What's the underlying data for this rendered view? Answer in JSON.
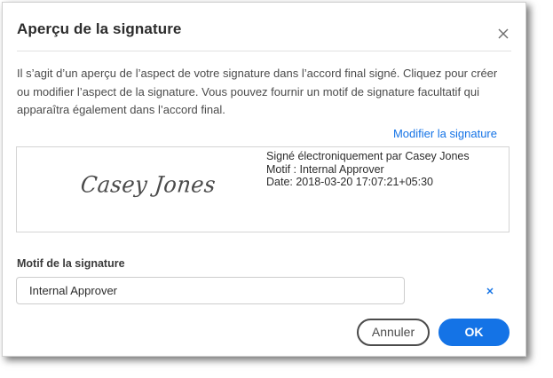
{
  "dialog": {
    "title": "Aperçu de la signature",
    "close_icon": "close-icon",
    "description": "Il s’agit d’un aperçu de l’aspect de votre signature dans l’accord final signé. Cliquez pour créer ou modifier l’aspect de la signature. Vous pouvez fournir un motif de signature facultatif qui apparaîtra également dans l’accord final.",
    "modify_link": "Modifier la signature"
  },
  "preview": {
    "signature_script": "Casey Jones",
    "signed_by": "Signé électroniquement par Casey Jones",
    "reason_line": "Motif : Internal Approver",
    "date_line": "Date: 2018-03-20 17:07:21+05:30"
  },
  "reason_field": {
    "label": "Motif de la signature",
    "value": "Internal Approver",
    "clear_icon": "clear-icon"
  },
  "buttons": {
    "cancel": "Annuler",
    "ok": "OK"
  },
  "colors": {
    "accent": "#1473e6",
    "text": "#2c2c2c",
    "muted_text": "#4b4b4b",
    "border": "#d4d4d4"
  }
}
